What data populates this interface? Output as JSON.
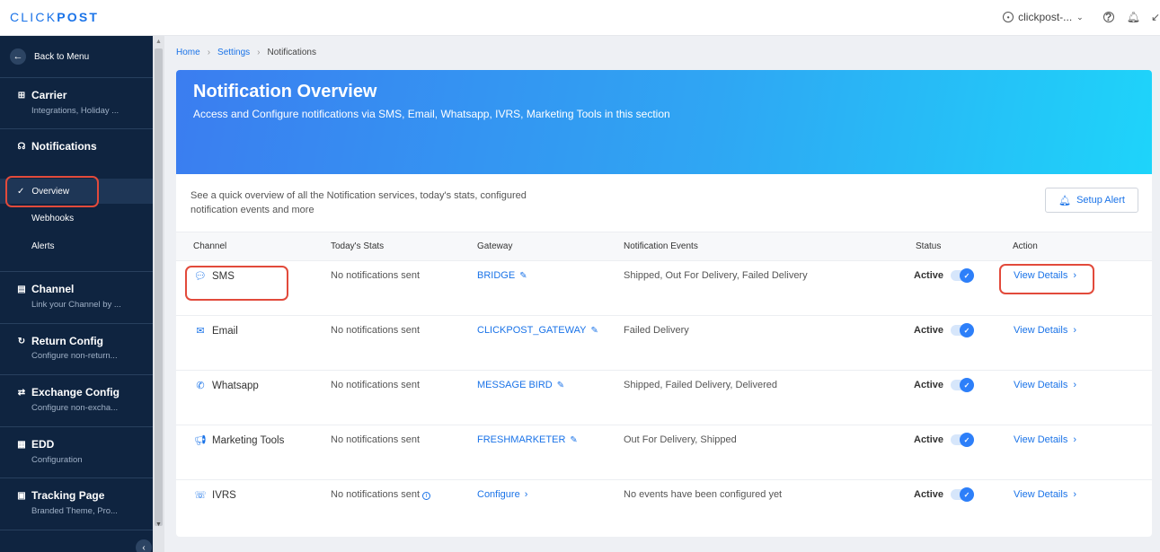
{
  "app": {
    "logo": "CLICKPOST",
    "account_name": "clickpost-...",
    "account_icon": "user-circle-icon",
    "help_icon": "question-circle-icon",
    "bell_icon": "bell-icon"
  },
  "sidebar": {
    "back_label": "Back to Menu",
    "sections": [
      {
        "title": "Carrier",
        "subtitle": "Integrations, Holiday ...",
        "icon": "carrier-icon"
      },
      {
        "title": "Notifications",
        "subtitle": "",
        "icon": "notification-icon",
        "items": [
          {
            "label": "Overview",
            "active": true
          },
          {
            "label": "Webhooks",
            "active": false
          },
          {
            "label": "Alerts",
            "active": false
          }
        ]
      },
      {
        "title": "Channel",
        "subtitle": "Link your Channel by ...",
        "icon": "channel-icon"
      },
      {
        "title": "Return Config",
        "subtitle": "Configure non-return...",
        "icon": "return-icon"
      },
      {
        "title": "Exchange Config",
        "subtitle": "Configure non-excha...",
        "icon": "exchange-icon"
      },
      {
        "title": "EDD",
        "subtitle": "Configuration",
        "icon": "calendar-icon"
      },
      {
        "title": "Tracking Page",
        "subtitle": "Branded Theme, Pro...",
        "icon": "tracking-page-icon"
      }
    ]
  },
  "breadcrumb": [
    "Home",
    "Settings",
    "Notifications"
  ],
  "banner": {
    "title": "Notification Overview",
    "subtitle": "Access and Configure notifications via SMS, Email, Whatsapp, IVRS, Marketing Tools in this section"
  },
  "intro": "See a quick overview of all the Notification services, today's stats, configured notification events and more",
  "setup_alert_label": "Setup Alert",
  "table": {
    "columns": [
      "Channel",
      "Today's Stats",
      "Gateway",
      "Notification Events",
      "Status",
      "Action"
    ],
    "rows": [
      {
        "channel": "SMS",
        "icon": "sms-icon",
        "stats": "No notifications sent",
        "gateway": "BRIDGE",
        "gateway_editable": true,
        "events": "Shipped, Out For Delivery, Failed Delivery",
        "status": "Active",
        "action": "View Details"
      },
      {
        "channel": "Email",
        "icon": "email-icon",
        "stats": "No notifications sent",
        "gateway": "CLICKPOST_GATEWAY",
        "gateway_editable": true,
        "events": "Failed Delivery",
        "status": "Active",
        "action": "View Details"
      },
      {
        "channel": "Whatsapp",
        "icon": "whatsapp-icon",
        "stats": "No notifications sent",
        "gateway": "MESSAGE BIRD",
        "gateway_editable": true,
        "events": "Shipped, Failed Delivery, Delivered",
        "status": "Active",
        "action": "View Details"
      },
      {
        "channel": "Marketing Tools",
        "icon": "megaphone-icon",
        "stats": "No notifications sent",
        "gateway": "FRESHMARKETER",
        "gateway_editable": true,
        "events": "Out For Delivery, Shipped",
        "status": "Active",
        "action": "View Details"
      },
      {
        "channel": "IVRS",
        "icon": "phone-icon",
        "stats": "No notifications sent",
        "gateway": "Configure",
        "gateway_editable": false,
        "events": "No events have been configured yet",
        "status": "Active",
        "action": "View Details"
      }
    ]
  },
  "colors": {
    "accent": "#1a73e8",
    "sidebar_bg": "#0f2440",
    "highlight": "#e24a3b"
  }
}
